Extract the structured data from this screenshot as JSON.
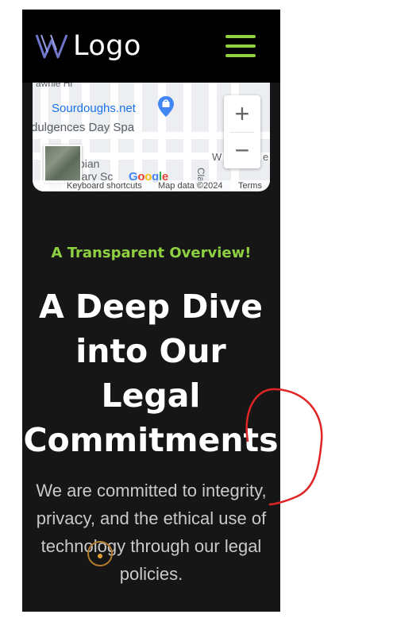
{
  "header": {
    "logo_text": "Logo",
    "menu_icon": "hamburger-menu-icon"
  },
  "map": {
    "labels": {
      "place_name": "Sourdoughs.net",
      "spa_name": "dulgences Day Spa",
      "partial_top": "awhie Hr",
      "partial_school_1": "bian",
      "partial_school_2": "ntary Sc",
      "street_w": "W",
      "street_e": "e",
      "street_clay": "Clay"
    },
    "zoom_in_label": "+",
    "zoom_out_label": "−",
    "google_logo": "Google",
    "footer": {
      "shortcuts": "Keyboard shortcuts",
      "map_data": "Map data ©2024",
      "terms": "Terms"
    }
  },
  "content": {
    "eyebrow": "A Transparent Overview!",
    "headline_lines": [
      "A Deep Dive",
      "into Our",
      "Legal",
      "Commitments"
    ],
    "body": "We are committed to integrity, privacy, and the ethical use of technology through our legal policies."
  },
  "colors": {
    "accent_green": "#8fd043",
    "background_dark": "#161616",
    "header_black": "#000000",
    "annotation_red": "#e02424"
  }
}
